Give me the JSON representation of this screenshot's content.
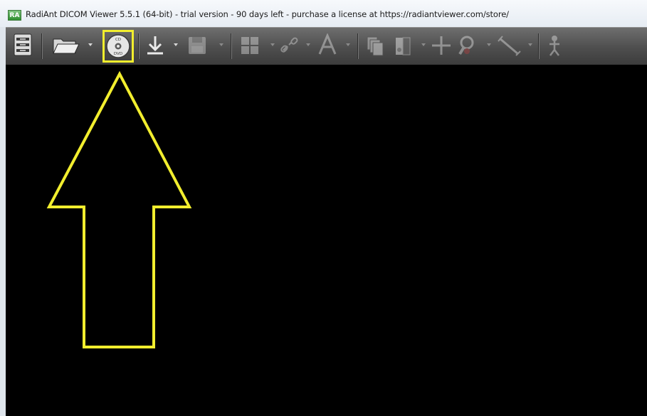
{
  "window": {
    "app_badge": "RA",
    "title": "RadiAnt DICOM Viewer 5.5.1 (64-bit) - trial version - 90 days left - purchase a license at https://radiantviewer.com/store/"
  },
  "toolbar": {
    "items": [
      {
        "name": "database-menu",
        "icon": "server-list-icon"
      },
      {
        "name": "open-folder",
        "icon": "folder-open-icon",
        "dropdown": true
      },
      {
        "name": "open-cd-dvd",
        "icon": "cd-dvd-icon",
        "label_top": "CD",
        "label_bottom": "DVD",
        "highlighted": true
      },
      {
        "name": "download",
        "icon": "download-arrow-icon",
        "dropdown": true
      },
      {
        "name": "save",
        "icon": "floppy-disk-icon",
        "dropdown": true,
        "disabled": true
      },
      {
        "name": "layout",
        "icon": "grid-layout-icon",
        "dropdown": true,
        "disabled": true
      },
      {
        "name": "link",
        "icon": "chain-link-icon",
        "dropdown": true,
        "disabled": true
      },
      {
        "name": "annotations",
        "icon": "text-a-icon",
        "dropdown": true,
        "disabled": true
      },
      {
        "name": "series",
        "icon": "stack-icon",
        "disabled": true
      },
      {
        "name": "window-level",
        "icon": "window-level-icon",
        "dropdown": true,
        "disabled": true
      },
      {
        "name": "pan",
        "icon": "move-cross-icon",
        "disabled": true
      },
      {
        "name": "zoom",
        "icon": "magnifier-icon",
        "dropdown": true,
        "disabled": true
      },
      {
        "name": "measure",
        "icon": "ruler-line-icon",
        "dropdown": true,
        "disabled": true
      },
      {
        "name": "3d",
        "icon": "skeleton-icon",
        "disabled": true
      }
    ]
  },
  "annotation": {
    "highlight_color": "#f2ee2e",
    "shape": "up-arrow-outline"
  },
  "viewer": {
    "background": "#000000"
  }
}
